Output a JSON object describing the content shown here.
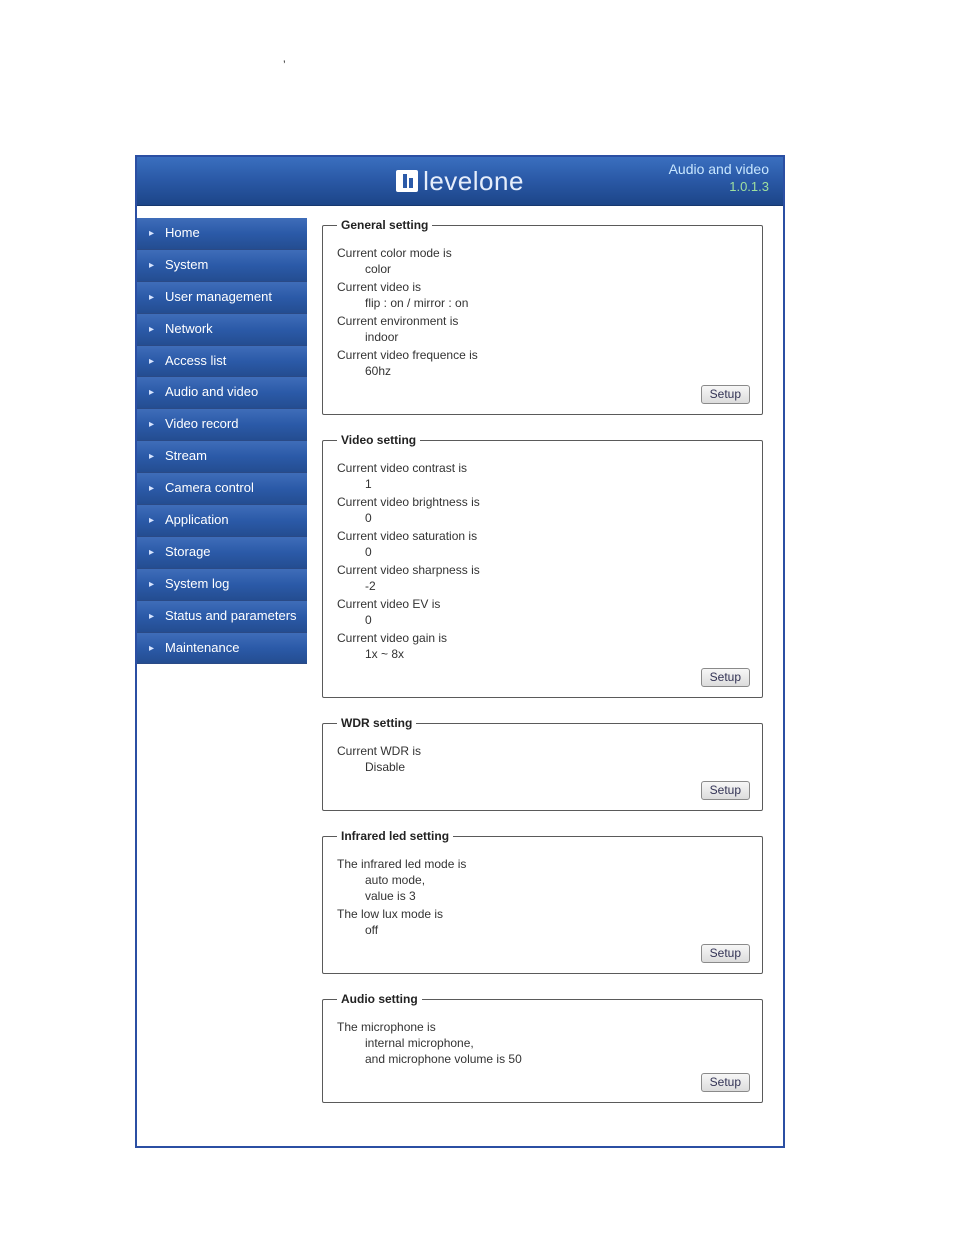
{
  "stray_mark": "’",
  "brand": {
    "text": "levelone"
  },
  "header": {
    "title": "Audio and video",
    "version": "1.0.1.3"
  },
  "nav": {
    "items": [
      {
        "label": "Home"
      },
      {
        "label": "System"
      },
      {
        "label": "User management"
      },
      {
        "label": "Network"
      },
      {
        "label": "Access list"
      },
      {
        "label": "Audio and video"
      },
      {
        "label": "Video record"
      },
      {
        "label": "Stream"
      },
      {
        "label": "Camera control"
      },
      {
        "label": "Application"
      },
      {
        "label": "Storage"
      },
      {
        "label": "System log"
      },
      {
        "label": "Status and parameters"
      },
      {
        "label": "Maintenance"
      }
    ]
  },
  "buttons": {
    "setup": "Setup"
  },
  "sections": {
    "general": {
      "legend": "General setting",
      "colorModeLabel": "Current color mode is",
      "colorModeValue": "color",
      "videoLabel": "Current video is",
      "videoValue": "flip : on / mirror : on",
      "envLabel": "Current environment is",
      "envValue": "indoor",
      "freqLabel": "Current video frequence is",
      "freqValue": "60hz"
    },
    "video": {
      "legend": "Video setting",
      "contrastLabel": "Current video contrast is",
      "contrastValue": "1",
      "brightnessLabel": "Current video brightness is",
      "brightnessValue": "0",
      "saturationLabel": "Current video saturation is",
      "saturationValue": "0",
      "sharpnessLabel": "Current video sharpness is",
      "sharpnessValue": "-2",
      "evLabel": "Current video EV is",
      "evValue": "0",
      "gainLabel": "Current video gain is",
      "gainValue": "1x ~ 8x"
    },
    "wdr": {
      "legend": "WDR setting",
      "label": "Current WDR is",
      "value": "Disable"
    },
    "infrared": {
      "legend": "Infrared led setting",
      "modeLabel": "The infrared led mode is",
      "modeValue1": "auto mode,",
      "modeValue2": "value is 3",
      "lowLuxLabel": "The low lux mode is",
      "lowLuxValue": "off"
    },
    "audio": {
      "legend": "Audio setting",
      "micLabel": "The microphone is",
      "micValue1": "internal microphone,",
      "micValue2": "and microphone volume is 50"
    }
  }
}
